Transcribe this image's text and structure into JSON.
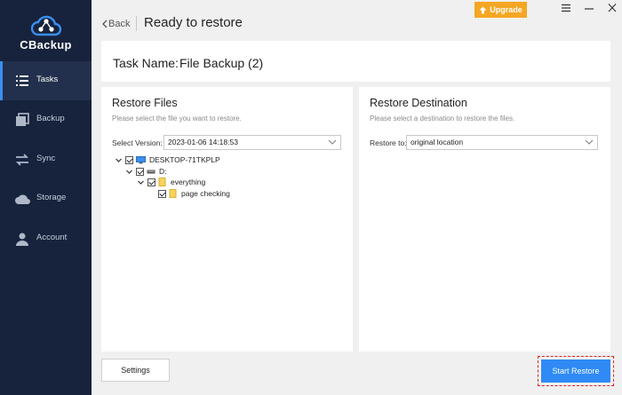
{
  "app": {
    "logo_text": "CBackup"
  },
  "sidebar": {
    "items": [
      {
        "label": "Tasks",
        "icon": "tasks-icon",
        "active": true
      },
      {
        "label": "Backup",
        "icon": "backup-icon",
        "active": false
      },
      {
        "label": "Sync",
        "icon": "sync-icon",
        "active": false
      },
      {
        "label": "Storage",
        "icon": "cloud-icon",
        "active": false
      },
      {
        "label": "Account",
        "icon": "user-icon",
        "active": false
      }
    ]
  },
  "topbar": {
    "back_label": "Back",
    "title": "Ready to restore",
    "upgrade_label": "Upgrade"
  },
  "task": {
    "label": "Task Name:",
    "name": "File Backup (2)"
  },
  "restore_files": {
    "title": "Restore Files",
    "subtitle": "Please select the file you want to restore.",
    "version_label": "Select Version:",
    "version_value": "2023-01-06 14:18:53",
    "tree": [
      {
        "label": "DESKTOP-71TKPLP",
        "icon": "computer-icon",
        "checked": true,
        "expanded": true
      },
      {
        "label": "D:",
        "icon": "drive-icon",
        "checked": true,
        "expanded": true
      },
      {
        "label": "everything",
        "icon": "folder-icon",
        "checked": true,
        "expanded": true
      },
      {
        "label": "page checking",
        "icon": "folder-icon",
        "checked": true
      }
    ]
  },
  "restore_destination": {
    "title": "Restore Destination",
    "subtitle": "Please select a destination to restore the files.",
    "restore_to_label": "Restore to:",
    "restore_to_value": "original location"
  },
  "footer": {
    "settings_label": "Settings",
    "start_label": "Start Restore"
  },
  "colors": {
    "sidebar": "#17233d",
    "accent": "#2f8af5",
    "upgrade": "#f5a623",
    "highlight": "#e02020"
  }
}
